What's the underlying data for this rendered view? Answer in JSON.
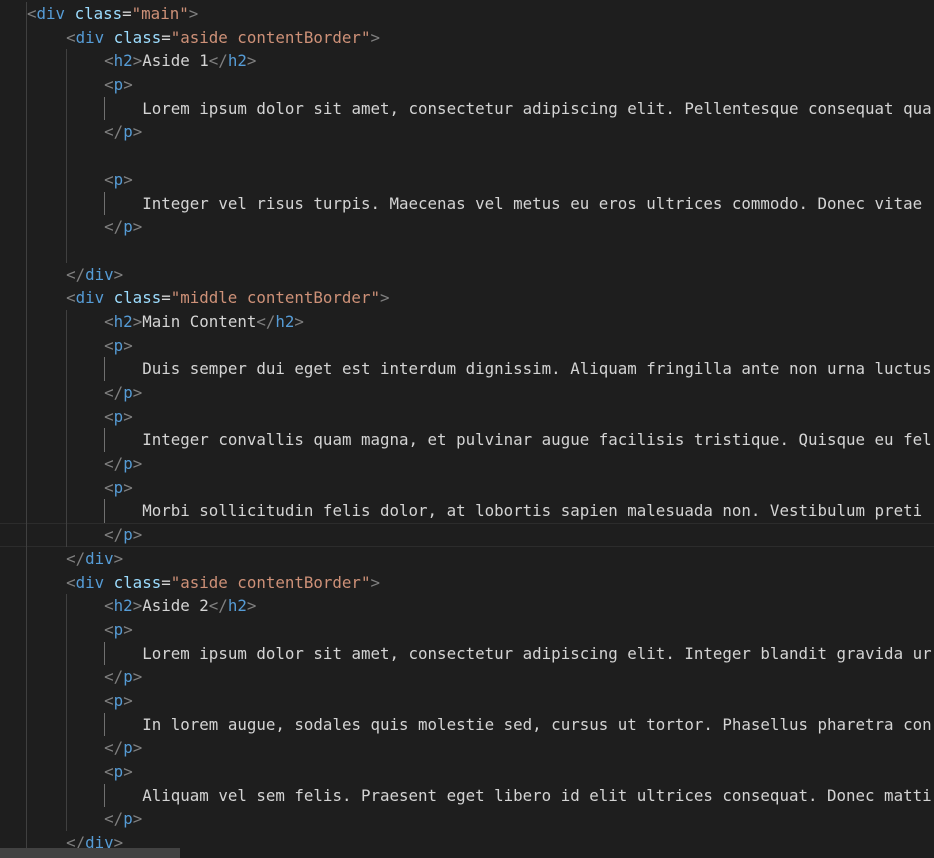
{
  "colors": {
    "background": "#1e1e1e",
    "tag": "#569cd6",
    "bracket": "#808080",
    "attribute": "#9cdcfe",
    "string": "#ce9178",
    "text": "#d4d4d4"
  },
  "lines": [
    {
      "indent": 0,
      "tokens": [
        [
          "b",
          "<"
        ],
        [
          "t",
          "div"
        ],
        [
          "x",
          " "
        ],
        [
          "a",
          "class"
        ],
        [
          "x",
          "="
        ],
        [
          "s",
          "\"main\""
        ],
        [
          "b",
          ">"
        ]
      ]
    },
    {
      "indent": 1,
      "tokens": [
        [
          "b",
          "<"
        ],
        [
          "t",
          "div"
        ],
        [
          "x",
          " "
        ],
        [
          "a",
          "class"
        ],
        [
          "x",
          "="
        ],
        [
          "s",
          "\"aside contentBorder\""
        ],
        [
          "b",
          ">"
        ]
      ]
    },
    {
      "indent": 2,
      "tokens": [
        [
          "b",
          "<"
        ],
        [
          "t",
          "h2"
        ],
        [
          "b",
          ">"
        ],
        [
          "x",
          "Aside 1"
        ],
        [
          "b",
          "</"
        ],
        [
          "t",
          "h2"
        ],
        [
          "b",
          ">"
        ]
      ]
    },
    {
      "indent": 2,
      "tokens": [
        [
          "b",
          "<"
        ],
        [
          "t",
          "p"
        ],
        [
          "b",
          ">"
        ]
      ]
    },
    {
      "indent": 3,
      "tokens": [
        [
          "x",
          "Lorem ipsum dolor sit amet, consectetur adipiscing elit. Pellentesque consequat qua"
        ]
      ]
    },
    {
      "indent": 2,
      "tokens": [
        [
          "b",
          "</"
        ],
        [
          "t",
          "p"
        ],
        [
          "b",
          ">"
        ]
      ]
    },
    {
      "indent": 2,
      "tokens": []
    },
    {
      "indent": 2,
      "tokens": [
        [
          "b",
          "<"
        ],
        [
          "t",
          "p"
        ],
        [
          "b",
          ">"
        ]
      ]
    },
    {
      "indent": 3,
      "tokens": [
        [
          "x",
          "Integer vel risus turpis. Maecenas vel metus eu eros ultrices commodo. Donec vitae"
        ]
      ]
    },
    {
      "indent": 2,
      "tokens": [
        [
          "b",
          "</"
        ],
        [
          "t",
          "p"
        ],
        [
          "b",
          ">"
        ]
      ]
    },
    {
      "indent": 2,
      "tokens": []
    },
    {
      "indent": 1,
      "tokens": [
        [
          "b",
          "</"
        ],
        [
          "t",
          "div"
        ],
        [
          "b",
          ">"
        ]
      ]
    },
    {
      "indent": 1,
      "tokens": [
        [
          "b",
          "<"
        ],
        [
          "t",
          "div"
        ],
        [
          "x",
          " "
        ],
        [
          "a",
          "class"
        ],
        [
          "x",
          "="
        ],
        [
          "s",
          "\"middle contentBorder\""
        ],
        [
          "b",
          ">"
        ]
      ]
    },
    {
      "indent": 2,
      "tokens": [
        [
          "b",
          "<"
        ],
        [
          "t",
          "h2"
        ],
        [
          "b",
          ">"
        ],
        [
          "x",
          "Main Content"
        ],
        [
          "b",
          "</"
        ],
        [
          "t",
          "h2"
        ],
        [
          "b",
          ">"
        ]
      ]
    },
    {
      "indent": 2,
      "tokens": [
        [
          "b",
          "<"
        ],
        [
          "t",
          "p"
        ],
        [
          "b",
          ">"
        ]
      ]
    },
    {
      "indent": 3,
      "tokens": [
        [
          "x",
          "Duis semper dui eget est interdum dignissim. Aliquam fringilla ante non urna luctus"
        ]
      ]
    },
    {
      "indent": 2,
      "tokens": [
        [
          "b",
          "</"
        ],
        [
          "t",
          "p"
        ],
        [
          "b",
          ">"
        ]
      ]
    },
    {
      "indent": 2,
      "tokens": [
        [
          "b",
          "<"
        ],
        [
          "t",
          "p"
        ],
        [
          "b",
          ">"
        ]
      ]
    },
    {
      "indent": 3,
      "tokens": [
        [
          "x",
          "Integer convallis quam magna, et pulvinar augue facilisis tristique. Quisque eu fel"
        ]
      ]
    },
    {
      "indent": 2,
      "tokens": [
        [
          "b",
          "</"
        ],
        [
          "t",
          "p"
        ],
        [
          "b",
          ">"
        ]
      ]
    },
    {
      "indent": 2,
      "tokens": [
        [
          "b",
          "<"
        ],
        [
          "t",
          "p"
        ],
        [
          "b",
          ">"
        ]
      ]
    },
    {
      "indent": 3,
      "tokens": [
        [
          "x",
          "Morbi sollicitudin felis dolor, at lobortis sapien malesuada non. Vestibulum preti"
        ]
      ]
    },
    {
      "indent": 2,
      "tokens": [
        [
          "b",
          "</"
        ],
        [
          "t",
          "p"
        ],
        [
          "b",
          ">"
        ]
      ],
      "current": true
    },
    {
      "indent": 1,
      "tokens": [
        [
          "b",
          "</"
        ],
        [
          "t",
          "div"
        ],
        [
          "b",
          ">"
        ]
      ]
    },
    {
      "indent": 1,
      "tokens": [
        [
          "b",
          "<"
        ],
        [
          "t",
          "div"
        ],
        [
          "x",
          " "
        ],
        [
          "a",
          "class"
        ],
        [
          "x",
          "="
        ],
        [
          "s",
          "\"aside contentBorder\""
        ],
        [
          "b",
          ">"
        ]
      ]
    },
    {
      "indent": 2,
      "tokens": [
        [
          "b",
          "<"
        ],
        [
          "t",
          "h2"
        ],
        [
          "b",
          ">"
        ],
        [
          "x",
          "Aside 2"
        ],
        [
          "b",
          "</"
        ],
        [
          "t",
          "h2"
        ],
        [
          "b",
          ">"
        ]
      ]
    },
    {
      "indent": 2,
      "tokens": [
        [
          "b",
          "<"
        ],
        [
          "t",
          "p"
        ],
        [
          "b",
          ">"
        ]
      ]
    },
    {
      "indent": 3,
      "tokens": [
        [
          "x",
          "Lorem ipsum dolor sit amet, consectetur adipiscing elit. Integer blandit gravida ur"
        ]
      ]
    },
    {
      "indent": 2,
      "tokens": [
        [
          "b",
          "</"
        ],
        [
          "t",
          "p"
        ],
        [
          "b",
          ">"
        ]
      ]
    },
    {
      "indent": 2,
      "tokens": [
        [
          "b",
          "<"
        ],
        [
          "t",
          "p"
        ],
        [
          "b",
          ">"
        ]
      ]
    },
    {
      "indent": 3,
      "tokens": [
        [
          "x",
          "In lorem augue, sodales quis molestie sed, cursus ut tortor. Phasellus pharetra con"
        ]
      ]
    },
    {
      "indent": 2,
      "tokens": [
        [
          "b",
          "</"
        ],
        [
          "t",
          "p"
        ],
        [
          "b",
          ">"
        ]
      ]
    },
    {
      "indent": 2,
      "tokens": [
        [
          "b",
          "<"
        ],
        [
          "t",
          "p"
        ],
        [
          "b",
          ">"
        ]
      ]
    },
    {
      "indent": 3,
      "tokens": [
        [
          "x",
          "Aliquam vel sem felis. Praesent eget libero id elit ultrices consequat. Donec matti"
        ]
      ]
    },
    {
      "indent": 2,
      "tokens": [
        [
          "b",
          "</"
        ],
        [
          "t",
          "p"
        ],
        [
          "b",
          ">"
        ]
      ]
    },
    {
      "indent": 1,
      "tokens": [
        [
          "b",
          "</"
        ],
        [
          "t",
          "div"
        ],
        [
          "b",
          ">"
        ]
      ]
    }
  ]
}
